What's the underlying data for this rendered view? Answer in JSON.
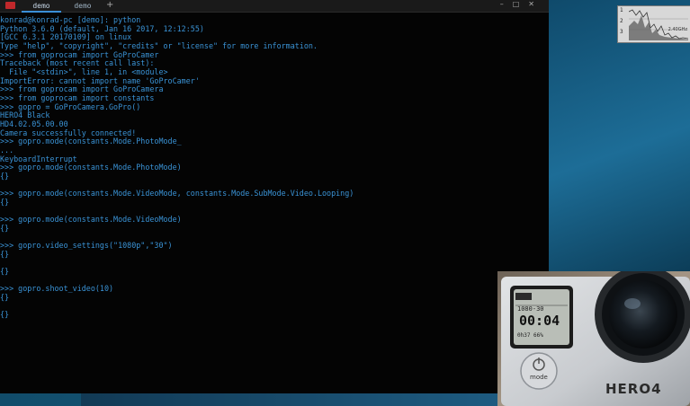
{
  "tabs": [
    {
      "label": "demo",
      "active": true
    },
    {
      "label": "demo",
      "active": false
    }
  ],
  "window_controls": [
    "–",
    "□",
    "✕"
  ],
  "terminal": {
    "lines": [
      "konrad@konrad-pc [demo]: python",
      "Python 3.6.0 (default, Jan 16 2017, 12:12:55)",
      "[GCC 6.3.1 20170109] on linux",
      "Type \"help\", \"copyright\", \"credits\" or \"license\" for more information.",
      ">>> from goprocam import GoProCamer",
      "Traceback (most recent call last):",
      "  File \"<stdin>\", line 1, in <module>",
      "ImportError: cannot import name 'GoProCamer'",
      ">>> from goprocam import GoProCamera",
      ">>> from goprocam import constants",
      ">>> gopro = GoProCamera.GoPro()",
      "HERO4 Black",
      "HD4.02.05.00.00",
      "Camera successfully connected!",
      ">>> gopro.mode(constants.Mode.PhotoMode_",
      "...",
      "KeyboardInterrupt",
      ">>> gopro.mode(constants.Mode.PhotoMode)",
      "{}",
      "",
      ">>> gopro.mode(constants.Mode.VideoMode, constants.Mode.SubMode.Video.Looping)",
      "{}",
      "",
      ">>> gopro.mode(constants.Mode.VideoMode)",
      "{}",
      "",
      ">>> gopro.video_settings(\"1080p\",\"30\")",
      "{}",
      "",
      "{}",
      "",
      ">>> gopro.shoot_video(10)",
      "{}",
      "",
      "{}"
    ]
  },
  "monitor_widget": {
    "labels": [
      "1",
      "2",
      "3"
    ],
    "frequency": "2.40GHz"
  },
  "camera": {
    "lcd_mode": "1080-30",
    "lcd_time": "00:04",
    "lcd_bottom": "0h37 66%",
    "brand": "HERO4",
    "button_label": "mode"
  },
  "colors": {
    "terminal_bg": "#040404",
    "terminal_text": "#3a93d6",
    "tab_accent": "#3a8fd8",
    "close_red": "#c0282b"
  }
}
